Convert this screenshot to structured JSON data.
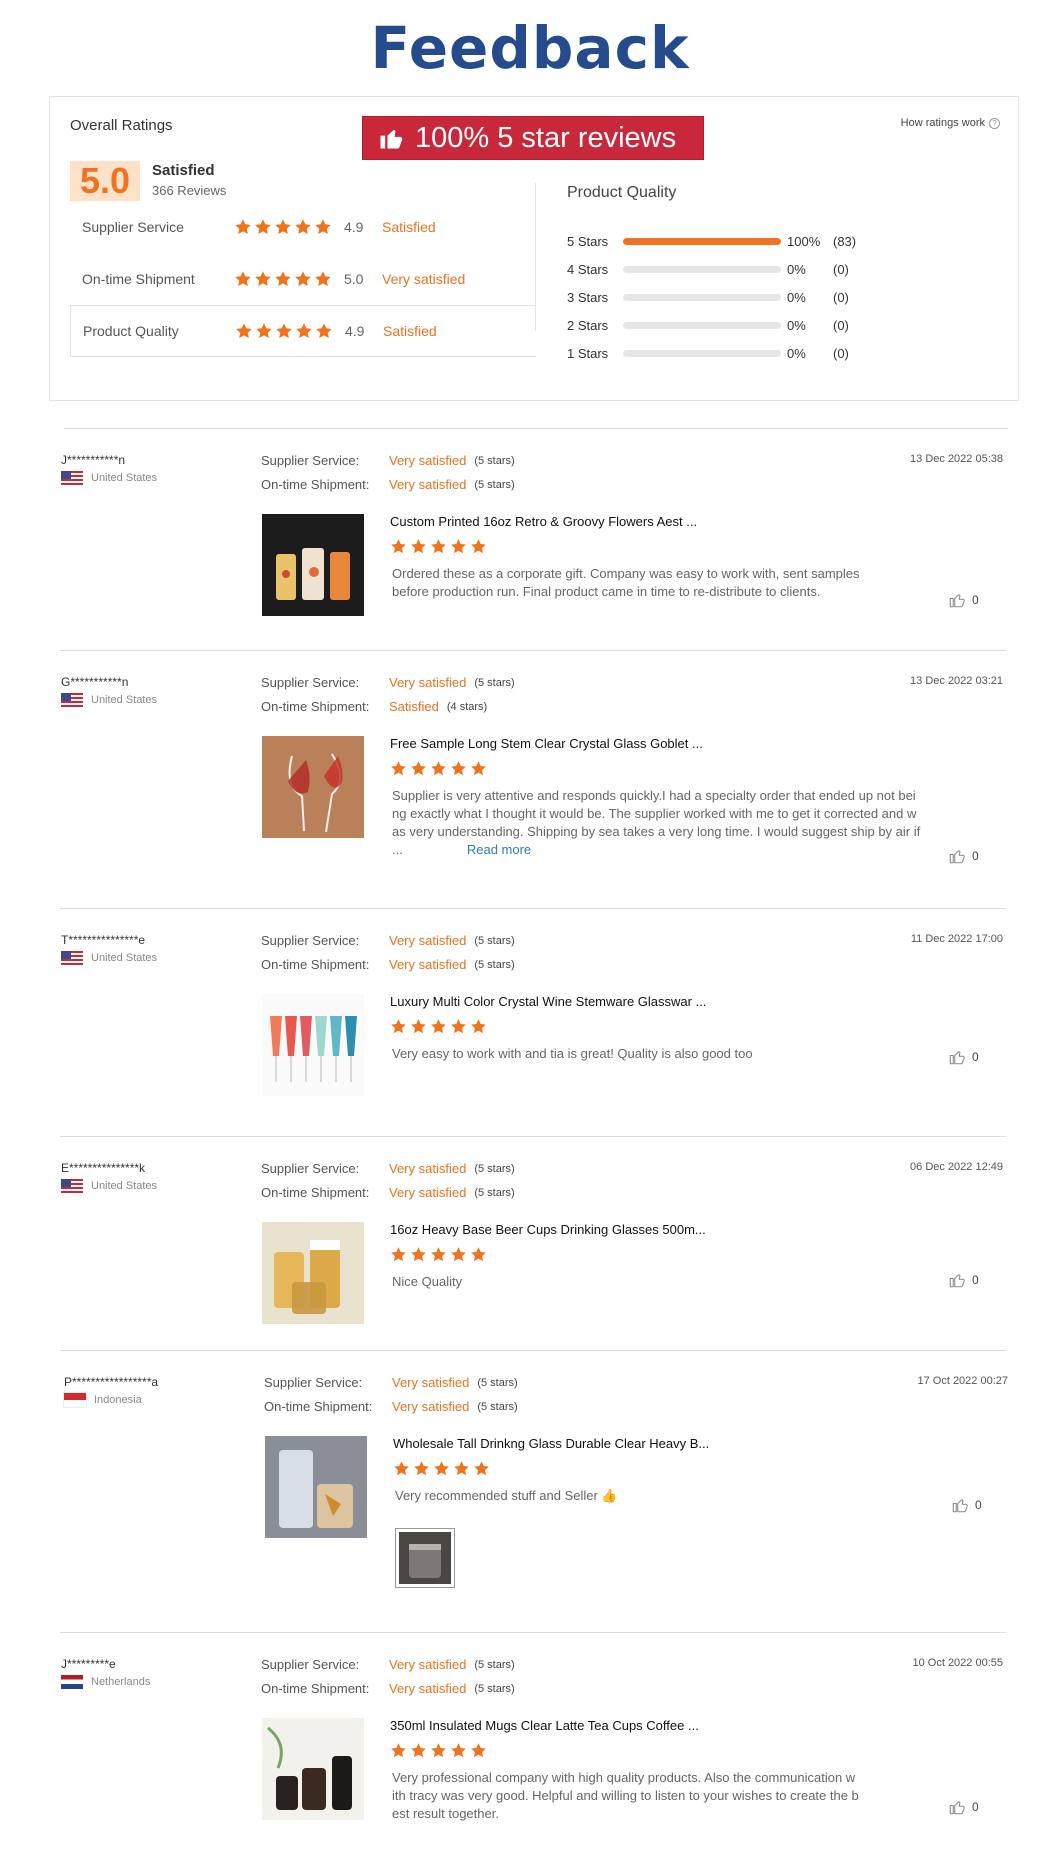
{
  "page_title": "Feedback",
  "summary": {
    "overall_label": "Overall Ratings",
    "banner_text": "100% 5 star reviews",
    "how_ratings_work": "How ratings work",
    "score": "5.0",
    "score_word": "Satisfied",
    "review_count": "366 Reviews",
    "rows": [
      {
        "label": "Supplier Service",
        "stars": 5,
        "value": "4.9",
        "word": "Satisfied"
      },
      {
        "label": "On-time Shipment",
        "stars": 5,
        "value": "5.0",
        "word": "Very satisfied"
      },
      {
        "label": "Product Quality",
        "stars": 5,
        "value": "4.9",
        "word": "Satisfied"
      }
    ],
    "product_quality_title": "Product Quality",
    "distribution": [
      {
        "label": "5 Stars",
        "fraction": 1.0,
        "pct": "100%",
        "count": "(83)"
      },
      {
        "label": "4 Stars",
        "fraction": 0,
        "pct": "0%",
        "count": "(0)"
      },
      {
        "label": "3 Stars",
        "fraction": 0,
        "pct": "0%",
        "count": "(0)"
      },
      {
        "label": "2 Stars",
        "fraction": 0,
        "pct": "0%",
        "count": "(0)"
      },
      {
        "label": "1 Stars",
        "fraction": 0,
        "pct": "0%",
        "count": "(0)"
      }
    ]
  },
  "labels": {
    "supplier_service": "Supplier Service:",
    "ontime_shipment": "On-time Shipment:",
    "read_more": "Read more"
  },
  "reviews": [
    {
      "user": "J***********n",
      "country": "United States",
      "flag": "us",
      "service": "Very satisfied",
      "service_stars": "(5 stars)",
      "shipment": "Very satisfied",
      "shipment_stars": "(5 stars)",
      "date": "13 Dec 2022 05:38",
      "product": "Custom Printed 16oz Retro & Groovy Flowers Aest ...",
      "rating": 5,
      "comment": [
        "Ordered these as a corporate gift. Company was easy to work with, sent samples",
        "before production run. Final product came in time to re-distribute to clients."
      ],
      "likes": "0"
    },
    {
      "user": "G***********n",
      "country": "United States",
      "flag": "us",
      "service": "Very satisfied",
      "service_stars": "(5 stars)",
      "shipment": "Satisfied",
      "shipment_stars": "(4 stars)",
      "date": "13 Dec 2022 03:21",
      "product": "Free Sample Long Stem Clear Crystal Glass Goblet ...",
      "rating": 5,
      "comment": [
        "Supplier is very attentive and responds quickly.I had a specialty order that ended up not bei",
        "ng exactly what I thought it would be. The supplier worked with me to get it corrected and w",
        "as very understanding.  Shipping by sea takes a very long time. I would suggest ship by air if",
        "..."
      ],
      "likes": "0"
    },
    {
      "user": "T***************e",
      "country": "United States",
      "flag": "us",
      "service": "Very satisfied",
      "service_stars": "(5 stars)",
      "shipment": "Very satisfied",
      "shipment_stars": "(5 stars)",
      "date": "11 Dec 2022 17:00",
      "product": "Luxury Multi Color Crystal Wine Stemware Glasswar ...",
      "rating": 5,
      "comment": [
        "Very easy to work with and tia is great!  Quality is also good too"
      ],
      "likes": "0"
    },
    {
      "user": "E***************k",
      "country": "United States",
      "flag": "us",
      "service": "Very satisfied",
      "service_stars": "(5 stars)",
      "shipment": "Very satisfied",
      "shipment_stars": "(5 stars)",
      "date": "06 Dec 2022 12:49",
      "product": "16oz Heavy Base Beer Cups Drinking Glasses 500m...",
      "rating": 5,
      "comment": [
        "Nice Quality"
      ],
      "likes": "0"
    },
    {
      "user": "P*****************a",
      "country": "Indonesia",
      "flag": "id",
      "service": "Very satisfied",
      "service_stars": "(5 stars)",
      "shipment": "Very satisfied",
      "shipment_stars": "(5 stars)",
      "date": "17 Oct 2022 00:27",
      "product": "Wholesale Tall Drinkng Glass Durable Clear Heavy B...",
      "rating": 5,
      "comment": [
        "Very recommended stuff and Seller 👍"
      ],
      "likes": "0"
    },
    {
      "user": "J*********e",
      "country": "Netherlands",
      "flag": "nl",
      "service": "Very satisfied",
      "service_stars": "(5 stars)",
      "shipment": "Very satisfied",
      "shipment_stars": "(5 stars)",
      "date": "10 Oct 2022 00:55",
      "product": "350ml Insulated Mugs Clear Latte Tea Cups Coffee ...",
      "rating": 5,
      "comment": [
        "Very professional company with high quality products. Also the communication w",
        "ith tracy was very good. Helpful and willing to listen to your wishes to create the b",
        "est result together."
      ],
      "likes": "0"
    }
  ],
  "colors": {
    "accent": "#ef7322",
    "title": "#244b8c",
    "banner": "#c8283a",
    "link": "#2e7ac1"
  }
}
